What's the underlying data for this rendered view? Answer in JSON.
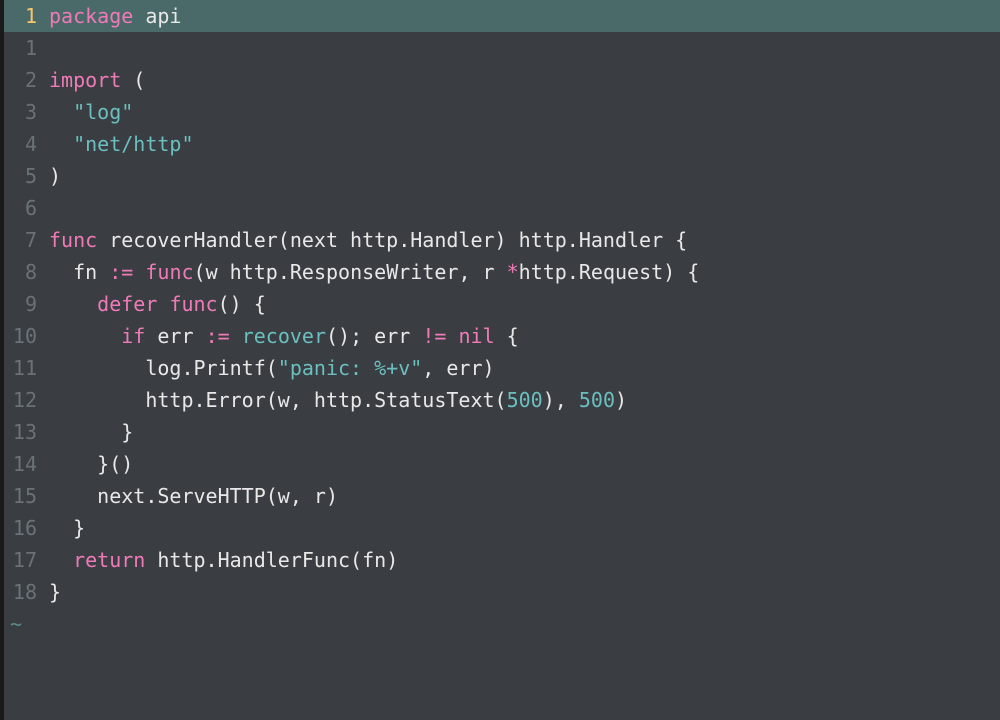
{
  "editor": {
    "cursor_line_gutter": "1",
    "lines": [
      {
        "rel": "1",
        "tokens": [
          {
            "cls": "tok-keyword",
            "text": "package"
          },
          {
            "cls": "tok-ident",
            "text": " api"
          }
        ]
      },
      {
        "rel": "1",
        "tokens": []
      },
      {
        "rel": "2",
        "tokens": [
          {
            "cls": "tok-keyword",
            "text": "import"
          },
          {
            "cls": "tok-ident",
            "text": " "
          },
          {
            "cls": "tok-paren",
            "text": "("
          }
        ]
      },
      {
        "rel": "3",
        "tokens": [
          {
            "cls": "tok-ident",
            "text": "  "
          },
          {
            "cls": "tok-string",
            "text": "\"log\""
          }
        ]
      },
      {
        "rel": "4",
        "tokens": [
          {
            "cls": "tok-ident",
            "text": "  "
          },
          {
            "cls": "tok-string",
            "text": "\"net/http\""
          }
        ]
      },
      {
        "rel": "5",
        "tokens": [
          {
            "cls": "tok-paren",
            "text": ")"
          }
        ]
      },
      {
        "rel": "6",
        "tokens": []
      },
      {
        "rel": "7",
        "tokens": [
          {
            "cls": "tok-keyword",
            "text": "func"
          },
          {
            "cls": "tok-ident",
            "text": " recoverHandler"
          },
          {
            "cls": "tok-paren",
            "text": "("
          },
          {
            "cls": "tok-ident",
            "text": "next http.Handler"
          },
          {
            "cls": "tok-paren",
            "text": ")"
          },
          {
            "cls": "tok-ident",
            "text": " http.Handler "
          },
          {
            "cls": "tok-paren",
            "text": "{"
          }
        ]
      },
      {
        "rel": "8",
        "tokens": [
          {
            "cls": "tok-ident",
            "text": "  fn "
          },
          {
            "cls": "tok-op",
            "text": ":="
          },
          {
            "cls": "tok-ident",
            "text": " "
          },
          {
            "cls": "tok-keyword",
            "text": "func"
          },
          {
            "cls": "tok-paren",
            "text": "("
          },
          {
            "cls": "tok-ident",
            "text": "w http.ResponseWriter, r "
          },
          {
            "cls": "tok-op",
            "text": "*"
          },
          {
            "cls": "tok-ident",
            "text": "http.Request"
          },
          {
            "cls": "tok-paren",
            "text": ")"
          },
          {
            "cls": "tok-ident",
            "text": " "
          },
          {
            "cls": "tok-paren",
            "text": "{"
          }
        ]
      },
      {
        "rel": "9",
        "tokens": [
          {
            "cls": "tok-ident",
            "text": "    "
          },
          {
            "cls": "tok-keyword",
            "text": "defer"
          },
          {
            "cls": "tok-ident",
            "text": " "
          },
          {
            "cls": "tok-keyword",
            "text": "func"
          },
          {
            "cls": "tok-paren",
            "text": "()"
          },
          {
            "cls": "tok-ident",
            "text": " "
          },
          {
            "cls": "tok-paren",
            "text": "{"
          }
        ]
      },
      {
        "rel": "10",
        "tokens": [
          {
            "cls": "tok-ident",
            "text": "      "
          },
          {
            "cls": "tok-keyword",
            "text": "if"
          },
          {
            "cls": "tok-ident",
            "text": " err "
          },
          {
            "cls": "tok-op",
            "text": ":="
          },
          {
            "cls": "tok-ident",
            "text": " "
          },
          {
            "cls": "tok-builtin",
            "text": "recover"
          },
          {
            "cls": "tok-paren",
            "text": "()"
          },
          {
            "cls": "tok-ident",
            "text": "; err "
          },
          {
            "cls": "tok-op",
            "text": "!="
          },
          {
            "cls": "tok-ident",
            "text": " "
          },
          {
            "cls": "tok-keyword",
            "text": "nil"
          },
          {
            "cls": "tok-ident",
            "text": " "
          },
          {
            "cls": "tok-paren",
            "text": "{"
          }
        ]
      },
      {
        "rel": "11",
        "tokens": [
          {
            "cls": "tok-ident",
            "text": "        log.Printf"
          },
          {
            "cls": "tok-paren",
            "text": "("
          },
          {
            "cls": "tok-string",
            "text": "\"panic: %+v\""
          },
          {
            "cls": "tok-ident",
            "text": ", err"
          },
          {
            "cls": "tok-paren",
            "text": ")"
          }
        ]
      },
      {
        "rel": "12",
        "tokens": [
          {
            "cls": "tok-ident",
            "text": "        http.Error"
          },
          {
            "cls": "tok-paren",
            "text": "("
          },
          {
            "cls": "tok-ident",
            "text": "w, http.StatusText"
          },
          {
            "cls": "tok-paren",
            "text": "("
          },
          {
            "cls": "tok-number",
            "text": "500"
          },
          {
            "cls": "tok-paren",
            "text": ")"
          },
          {
            "cls": "tok-ident",
            "text": ", "
          },
          {
            "cls": "tok-number",
            "text": "500"
          },
          {
            "cls": "tok-paren",
            "text": ")"
          }
        ]
      },
      {
        "rel": "13",
        "tokens": [
          {
            "cls": "tok-ident",
            "text": "      "
          },
          {
            "cls": "tok-paren",
            "text": "}"
          }
        ]
      },
      {
        "rel": "14",
        "tokens": [
          {
            "cls": "tok-ident",
            "text": "    "
          },
          {
            "cls": "tok-paren",
            "text": "}()"
          }
        ]
      },
      {
        "rel": "15",
        "tokens": [
          {
            "cls": "tok-ident",
            "text": "    next.ServeHTTP"
          },
          {
            "cls": "tok-paren",
            "text": "("
          },
          {
            "cls": "tok-ident",
            "text": "w, r"
          },
          {
            "cls": "tok-paren",
            "text": ")"
          }
        ]
      },
      {
        "rel": "16",
        "tokens": [
          {
            "cls": "tok-ident",
            "text": "  "
          },
          {
            "cls": "tok-paren",
            "text": "}"
          }
        ]
      },
      {
        "rel": "17",
        "tokens": [
          {
            "cls": "tok-ident",
            "text": "  "
          },
          {
            "cls": "tok-keyword",
            "text": "return"
          },
          {
            "cls": "tok-ident",
            "text": " http.HandlerFunc"
          },
          {
            "cls": "tok-paren",
            "text": "("
          },
          {
            "cls": "tok-ident",
            "text": "fn"
          },
          {
            "cls": "tok-paren",
            "text": ")"
          }
        ]
      },
      {
        "rel": "18",
        "tokens": [
          {
            "cls": "tok-paren",
            "text": "}"
          }
        ]
      }
    ],
    "tilde": "~"
  }
}
